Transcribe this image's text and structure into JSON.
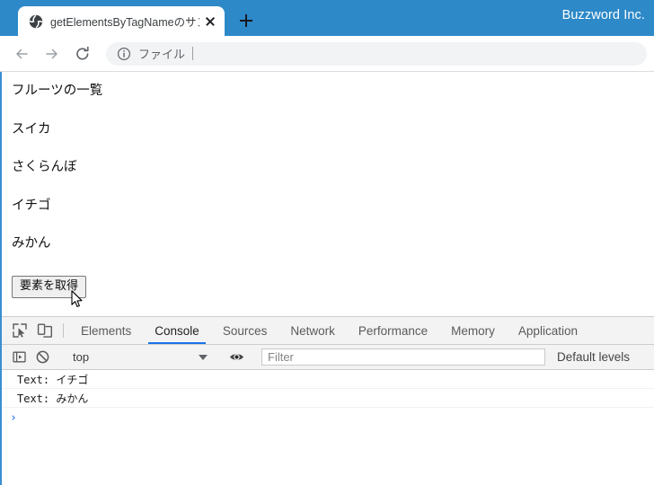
{
  "window": {
    "brand_label": "Buzzword Inc."
  },
  "tabstrip": {
    "tabs": [
      {
        "title": "getElementsByTagNameのサンプル",
        "favicon": "globe-icon",
        "close_label": "×"
      }
    ],
    "new_tab_label": "+"
  },
  "toolbar": {
    "back_label": "←",
    "forward_label": "→",
    "reload_label": "⟳",
    "omnibox": {
      "icon": "info-circle-icon",
      "value": "ファイル",
      "placeholder": "ファイル"
    }
  },
  "page": {
    "lines": [
      "フルーツの一覧",
      "スイカ",
      "さくらんぼ",
      "イチゴ",
      "みかん"
    ],
    "button_label": "要素を取得",
    "cursor": "arrow-pointer"
  },
  "devtools": {
    "icons": {
      "inspect": "inspect-element-icon",
      "device": "device-toolbar-icon",
      "sidebar": "console-sidebar-icon",
      "clear": "clear-console-icon",
      "eye": "live-expression-eye-icon"
    },
    "tabs": [
      {
        "label": "Elements",
        "active": false
      },
      {
        "label": "Console",
        "active": true
      },
      {
        "label": "Sources",
        "active": false
      },
      {
        "label": "Network",
        "active": false
      },
      {
        "label": "Performance",
        "active": false
      },
      {
        "label": "Memory",
        "active": false
      },
      {
        "label": "Application",
        "active": false
      }
    ],
    "console_toolbar": {
      "context": "top",
      "filter_placeholder": "Filter",
      "filter_value": "",
      "levels_label": "Default levels"
    },
    "console_messages": [
      "Text: イチゴ",
      "Text: みかん"
    ],
    "prompt_symbol": "›"
  },
  "colors": {
    "titlebar_blue": "#2d89c8",
    "accent_blue": "#1a73e8",
    "page_border_blue": "#3a8fd0",
    "devtools_bg": "#f3f3f3"
  }
}
